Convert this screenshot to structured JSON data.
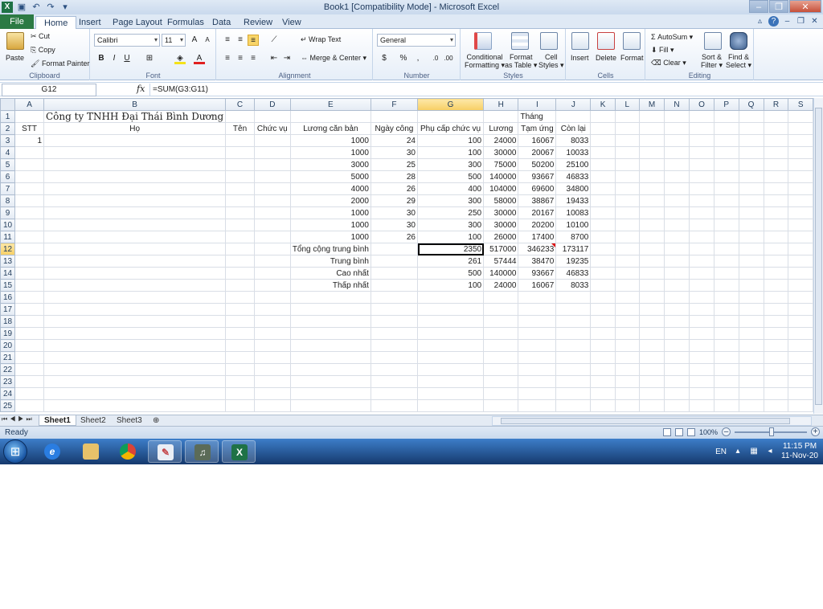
{
  "window": {
    "title": "Book1  [Compatibility Mode]  -  Microsoft Excel",
    "app_icon": "X",
    "qat": [
      "save-icon",
      "undo-icon",
      "redo-icon",
      "customize-icon"
    ],
    "controls": [
      "minimize-icon",
      "restore-icon",
      "close-icon"
    ]
  },
  "tabs": [
    "File",
    "Home",
    "Insert",
    "Page Layout",
    "Formulas",
    "Data",
    "Review",
    "View"
  ],
  "ribbon": {
    "clipboard": {
      "paste": "Paste",
      "cut": "Cut",
      "copy": "Copy",
      "format_painter": "Format Painter",
      "label": "Clipboard"
    },
    "font": {
      "name": "Calibri",
      "size": "11",
      "label": "Font",
      "bold": "B",
      "italic": "I",
      "underline": "U"
    },
    "alignment": {
      "wrap": "Wrap Text",
      "merge": "Merge & Center",
      "label": "Alignment"
    },
    "number": {
      "format": "General",
      "currency": "$",
      "percent": "%",
      "comma": ",",
      "label": "Number"
    },
    "styles": {
      "conditional": "Conditional",
      "conditional2": "Formatting",
      "format_as": "Format",
      "format_as2": "as Table",
      "cell": "Cell",
      "cell2": "Styles",
      "label": "Styles"
    },
    "cells": {
      "insert": "Insert",
      "delete": "Delete",
      "format": "Format",
      "label": "Cells"
    },
    "editing": {
      "autosum": "AutoSum",
      "fill": "Fill",
      "clear": "Clear",
      "sort": "Sort &",
      "sort2": "Filter",
      "find": "Find &",
      "find2": "Select",
      "label": "Editing"
    }
  },
  "formula_bar": {
    "name_box": "G12",
    "fx": "fx",
    "formula": "=SUM(G3:G11)"
  },
  "columns": [
    "A",
    "B",
    "C",
    "D",
    "E",
    "F",
    "G",
    "H",
    "I",
    "J",
    "K",
    "L",
    "M",
    "N",
    "O",
    "P",
    "Q",
    "R",
    "S"
  ],
  "selected_column": "G",
  "selected_row": "12",
  "rows": [
    [
      "1",
      "",
      "Công ty TNHH Đại Thái Bình Dương",
      "",
      "",
      "",
      "",
      "",
      "",
      "Tháng",
      "",
      "",
      "",
      "",
      "",
      "",
      "",
      "",
      "",
      ""
    ],
    [
      "2",
      "STT",
      "Họ",
      "Tên",
      "Chức vụ",
      "Lương căn bản",
      "Ngày công",
      "Phụ cấp chức vụ",
      "Lương",
      "Tạm ứng",
      "Còn lại",
      "",
      "",
      "",
      "",
      "",
      "",
      "",
      "",
      ""
    ],
    [
      "3",
      "1",
      "",
      "",
      "",
      "1000",
      "24",
      "100",
      "24000",
      "16067",
      "8033",
      "",
      "",
      "",
      "",
      "",
      "",
      "",
      "",
      ""
    ],
    [
      "4",
      "",
      "",
      "",
      "",
      "1000",
      "30",
      "100",
      "30000",
      "20067",
      "10033",
      "",
      "",
      "",
      "",
      "",
      "",
      "",
      "",
      ""
    ],
    [
      "5",
      "",
      "",
      "",
      "",
      "3000",
      "25",
      "300",
      "75000",
      "50200",
      "25100",
      "",
      "",
      "",
      "",
      "",
      "",
      "",
      "",
      ""
    ],
    [
      "6",
      "",
      "",
      "",
      "",
      "5000",
      "28",
      "500",
      "140000",
      "93667",
      "46833",
      "",
      "",
      "",
      "",
      "",
      "",
      "",
      "",
      ""
    ],
    [
      "7",
      "",
      "",
      "",
      "",
      "4000",
      "26",
      "400",
      "104000",
      "69600",
      "34800",
      "",
      "",
      "",
      "",
      "",
      "",
      "",
      "",
      ""
    ],
    [
      "8",
      "",
      "",
      "",
      "",
      "2000",
      "29",
      "300",
      "58000",
      "38867",
      "19433",
      "",
      "",
      "",
      "",
      "",
      "",
      "",
      "",
      ""
    ],
    [
      "9",
      "",
      "",
      "",
      "",
      "1000",
      "30",
      "250",
      "30000",
      "20167",
      "10083",
      "",
      "",
      "",
      "",
      "",
      "",
      "",
      "",
      ""
    ],
    [
      "10",
      "",
      "",
      "",
      "",
      "1000",
      "30",
      "300",
      "30000",
      "20200",
      "10100",
      "",
      "",
      "",
      "",
      "",
      "",
      "",
      "",
      ""
    ],
    [
      "11",
      "",
      "",
      "",
      "",
      "1000",
      "26",
      "100",
      "26000",
      "17400",
      "8700",
      "",
      "",
      "",
      "",
      "",
      "",
      "",
      "",
      ""
    ],
    [
      "12",
      "",
      "",
      "",
      "",
      "Tổng cộng trung bình",
      "",
      "2350",
      "517000",
      "346233",
      "173117",
      "",
      "",
      "",
      "",
      "",
      "",
      "",
      "",
      ""
    ],
    [
      "13",
      "",
      "",
      "",
      "",
      "Trung bình",
      "",
      "261",
      "57444",
      "38470",
      "19235",
      "",
      "",
      "",
      "",
      "",
      "",
      "",
      "",
      ""
    ],
    [
      "14",
      "",
      "",
      "",
      "",
      "Cao nhất",
      "",
      "500",
      "140000",
      "93667",
      "46833",
      "",
      "",
      "",
      "",
      "",
      "",
      "",
      "",
      ""
    ],
    [
      "15",
      "",
      "",
      "",
      "",
      "Thấp nhất",
      "",
      "100",
      "24000",
      "16067",
      "8033",
      "",
      "",
      "",
      "",
      "",
      "",
      "",
      "",
      ""
    ],
    [
      "16",
      "",
      "",
      "",
      "",
      "",
      "",
      "",
      "",
      "",
      "",
      "",
      "",
      "",
      "",
      "",
      "",
      "",
      "",
      ""
    ],
    [
      "17",
      "",
      "",
      "",
      "",
      "",
      "",
      "",
      "",
      "",
      "",
      "",
      "",
      "",
      "",
      "",
      "",
      "",
      "",
      ""
    ],
    [
      "18",
      "",
      "",
      "",
      "",
      "",
      "",
      "",
      "",
      "",
      "",
      "",
      "",
      "",
      "",
      "",
      "",
      "",
      "",
      ""
    ],
    [
      "19",
      "",
      "",
      "",
      "",
      "",
      "",
      "",
      "",
      "",
      "",
      "",
      "",
      "",
      "",
      "",
      "",
      "",
      "",
      ""
    ],
    [
      "20",
      "",
      "",
      "",
      "",
      "",
      "",
      "",
      "",
      "",
      "",
      "",
      "",
      "",
      "",
      "",
      "",
      "",
      "",
      ""
    ],
    [
      "21",
      "",
      "",
      "",
      "",
      "",
      "",
      "",
      "",
      "",
      "",
      "",
      "",
      "",
      "",
      "",
      "",
      "",
      "",
      ""
    ],
    [
      "22",
      "",
      "",
      "",
      "",
      "",
      "",
      "",
      "",
      "",
      "",
      "",
      "",
      "",
      "",
      "",
      "",
      "",
      "",
      ""
    ],
    [
      "23",
      "",
      "",
      "",
      "",
      "",
      "",
      "",
      "",
      "",
      "",
      "",
      "",
      "",
      "",
      "",
      "",
      "",
      "",
      ""
    ],
    [
      "24",
      "",
      "",
      "",
      "",
      "",
      "",
      "",
      "",
      "",
      "",
      "",
      "",
      "",
      "",
      "",
      "",
      "",
      "",
      ""
    ],
    [
      "25",
      "",
      "",
      "",
      "",
      "",
      "",
      "",
      "",
      "",
      "",
      "",
      "",
      "",
      "",
      "",
      "",
      "",
      "",
      ""
    ]
  ],
  "sheet_tabs": [
    "Sheet1",
    "Sheet2",
    "Sheet3"
  ],
  "status": {
    "text": "Ready",
    "zoom": "100%"
  },
  "taskbar": {
    "apps": [
      "internet-explorer-icon",
      "file-explorer-icon",
      "chrome-icon",
      "paint-icon",
      "media-icon",
      "excel-icon"
    ],
    "lang": "EN",
    "time": "11:15 PM",
    "date": "11-Nov-20"
  },
  "colors": {
    "excel_green": "#1f7246",
    "selection_header": "#f7cf63",
    "ribbon_bg": "#e6eef8",
    "taskbar": "#15396d"
  }
}
